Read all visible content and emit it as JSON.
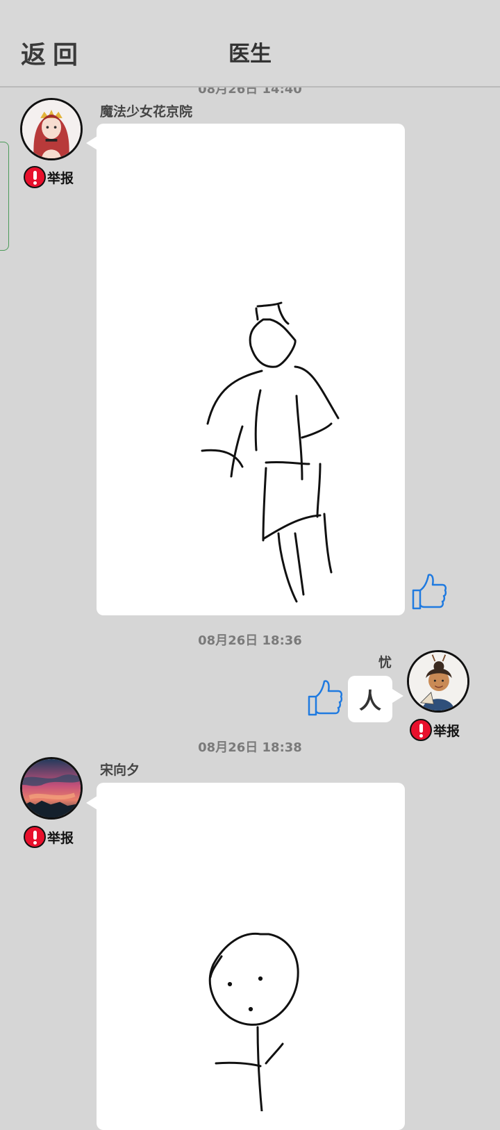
{
  "header": {
    "back_label": "返回",
    "title": "医生"
  },
  "messages": [
    {
      "timestamp": "08月26日 14:40",
      "username": "魔法少女花京院",
      "report_label": "举报",
      "avatar": "red-haired-anime-avatar",
      "content_type": "drawing",
      "drawing": "stick-figure-with-hat"
    },
    {
      "timestamp": "08月26日 18:36",
      "username": "忧",
      "report_label": "举报",
      "avatar": "ancient-lady-avatar",
      "content_type": "text",
      "text": "人"
    },
    {
      "timestamp": "08月26日 18:38",
      "username": "宋向夕",
      "report_label": "举报",
      "avatar": "sunset-sky-avatar",
      "content_type": "drawing",
      "drawing": "round-head-figure"
    }
  ],
  "icons": {
    "thumb": "thumbs-up-icon",
    "report": "exclamation-icon"
  },
  "colors": {
    "background": "#d6d6d6",
    "report_red": "#e8102c",
    "thumb_blue": "#1f7ae0"
  }
}
